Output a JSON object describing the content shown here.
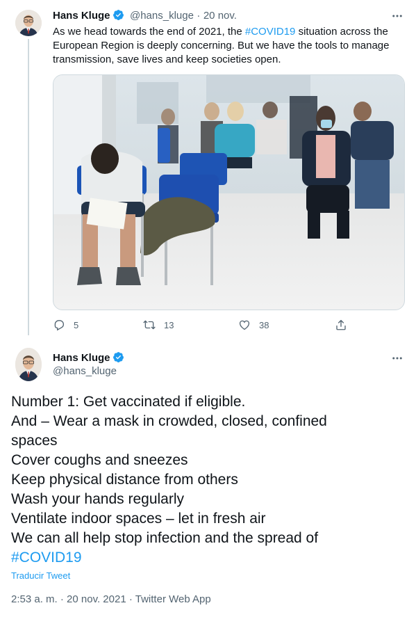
{
  "reply_tweet": {
    "author_name": "Hans Kluge",
    "author_handle": "@hans_kluge",
    "dot": "·",
    "date": "20 nov.",
    "text_before": "As we head towards the end of 2021, the ",
    "hashtag": "#COVID19",
    "text_after": " situation across the European Region is deeply concerning. But we have the tools to manage transmission, save lives and keep societies open.",
    "more_icon": "ellipsis-icon",
    "actions": {
      "replies": "5",
      "retweets": "13",
      "likes": "38"
    },
    "accent_color": "#1d9bf0"
  },
  "main_tweet": {
    "author_name": "Hans Kluge",
    "author_handle": "@hans_kluge",
    "lines": [
      "Number 1: Get vaccinated if eligible.",
      "And – Wear a mask in crowded, closed, confined",
      "spaces",
      "Cover coughs and sneezes",
      "Keep physical distance from others",
      "Wash your hands regularly",
      "Ventilate indoor spaces – let in fresh air",
      "We can all help stop infection and the spread of"
    ],
    "hashtag": "#COVID19",
    "translate_label": "Traducir Tweet",
    "timestamp": "2:53 a. m.",
    "dot": "·",
    "date": "20 nov. 2021",
    "dot2": "·",
    "source": "Twitter Web App"
  }
}
